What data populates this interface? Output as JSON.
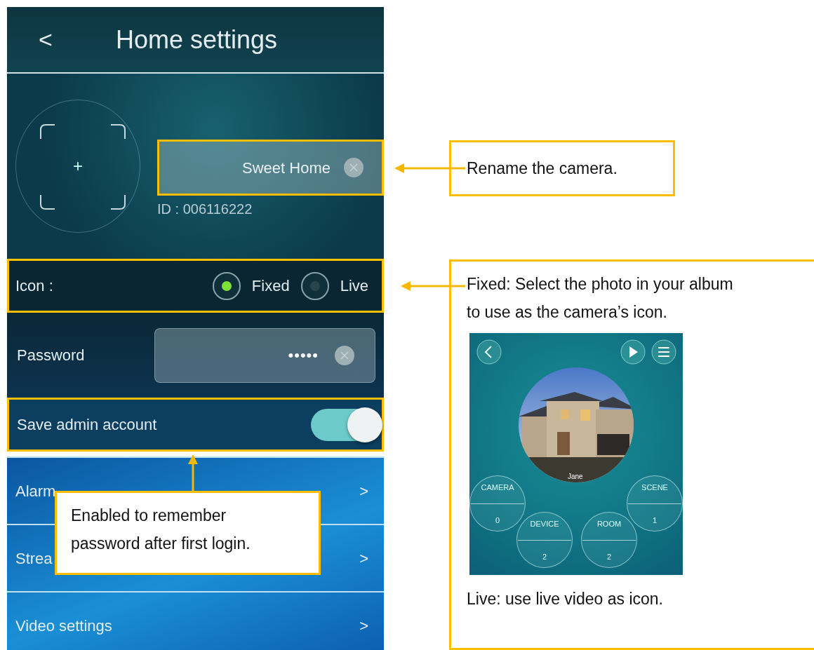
{
  "header": {
    "back": "<",
    "title": "Home settings"
  },
  "profile": {
    "avatar_plus": "+",
    "name": {
      "value": "Sweet Home",
      "highlighted": true
    },
    "id_text": "ID : 006116222"
  },
  "icon_row": {
    "label": "Icon :",
    "highlighted": true,
    "options": [
      {
        "label": "Fixed",
        "selected": true
      },
      {
        "label": "Live",
        "selected": false
      }
    ]
  },
  "password": {
    "label": "Password",
    "value": "•••••"
  },
  "save_admin": {
    "label": "Save admin account",
    "on": true,
    "highlighted": true
  },
  "menu": [
    {
      "label": "Alarm",
      "chevron": ">"
    },
    {
      "label": "Strea",
      "chevron": ">"
    },
    {
      "label": "Video settings",
      "chevron": ">"
    }
  ],
  "callouts": [
    {
      "text": "Rename the camera."
    },
    {
      "text": "Fixed: Select the photo in your album to use as the camera’s icon.",
      "footer": "Live: use live video as icon."
    },
    {
      "text": "Enabled to remember password after first login."
    }
  ],
  "example_screen": {
    "caption": "Jane",
    "tiles": [
      {
        "label": "CAMERA",
        "count": "0"
      },
      {
        "label": "DEVICE",
        "count": "2"
      },
      {
        "label": "ROOM",
        "count": "2"
      },
      {
        "label": "SCENE",
        "count": "1"
      }
    ]
  }
}
